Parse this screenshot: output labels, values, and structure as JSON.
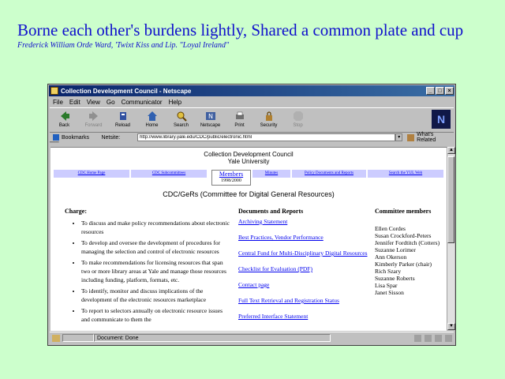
{
  "slide": {
    "title": "Borne each other's burdens lightly, Shared a common plate and cup",
    "attribution": "Frederick William Orde Ward, 'Twixt Kiss and Lip. \"Loyal Ireland\""
  },
  "window": {
    "title": "Collection Development Council - Netscape",
    "menu": [
      "File",
      "Edit",
      "View",
      "Go",
      "Communicator",
      "Help"
    ],
    "toolbar": [
      {
        "label": "Back",
        "icon": "back-icon",
        "enabled": true
      },
      {
        "label": "Forward",
        "icon": "forward-icon",
        "enabled": false
      },
      {
        "label": "Reload",
        "icon": "reload-icon",
        "enabled": true
      },
      {
        "label": "Home",
        "icon": "home-icon",
        "enabled": true
      },
      {
        "label": "Search",
        "icon": "search-icon",
        "enabled": true
      },
      {
        "label": "Netscape",
        "icon": "netscape-icon",
        "enabled": true
      },
      {
        "label": "Print",
        "icon": "print-icon",
        "enabled": true
      },
      {
        "label": "Security",
        "icon": "security-icon",
        "enabled": true
      },
      {
        "label": "Stop",
        "icon": "stop-icon",
        "enabled": false
      }
    ],
    "logo_text": "N",
    "bookmarks_label": "Bookmarks",
    "location_label": "Netsite:",
    "location_value": "http://www.library.yale.edu/CDC/public/electronic.html",
    "related_label": "What's Related",
    "status_text": "Document: Done",
    "colors": {
      "titlebar": "#0a246a",
      "link": "#0000ee",
      "navcell": "#ccccff",
      "slide_bg": "#ccffcc",
      "slide_text": "#1010cc"
    }
  },
  "page": {
    "org_line1": "Collection Development Council",
    "org_line2": "Yale University",
    "nav": [
      "CDC Home Page",
      "CDC Subcommittees",
      "Members",
      "Minutes",
      "Policy Documents and Reports",
      "Search the YUL Web"
    ],
    "members_date": "1998/2000",
    "subtitle": "CDC/GeRs (Committee for Digital General Resources)",
    "charge_heading": "Charge:",
    "charge_items": [
      "To discuss and make policy recommendations about electronic resources",
      "To develop and oversee the development of procedures for managing the selection and control of electronic resources",
      "To make recommendations for licensing resources that span two or more library areas at Yale and manage those resources including funding, platform, formats, etc.",
      "To identify, monitor and discuss implications of the development of the electronic resources marketplace",
      "To report to selectors annually on electronic resource issues and communicate to them the"
    ],
    "docs_heading": "Documents and Reports",
    "docs": [
      "Archiving Statement",
      "Best Practices, Vendor Performance",
      "Central Fund for Multi-Disciplinary Digital Resources",
      "Checklist for Evaluation (PDF)",
      "Contact page",
      "Full Text Retrieval and Registration Status",
      "Preferred Interface Statement"
    ],
    "members_heading": "Committee members",
    "members": [
      "Ellen Cordes",
      "Susan Crockford-Peters",
      "Jennifer Fordtitch (Cotters)",
      "Suzanne Lorimer",
      "Ann Okerson",
      "Kimberly Parker (chair)",
      "Rich Szary",
      "Suzanne Roberts",
      "Lisa Spar",
      "Janet Sisson"
    ]
  }
}
